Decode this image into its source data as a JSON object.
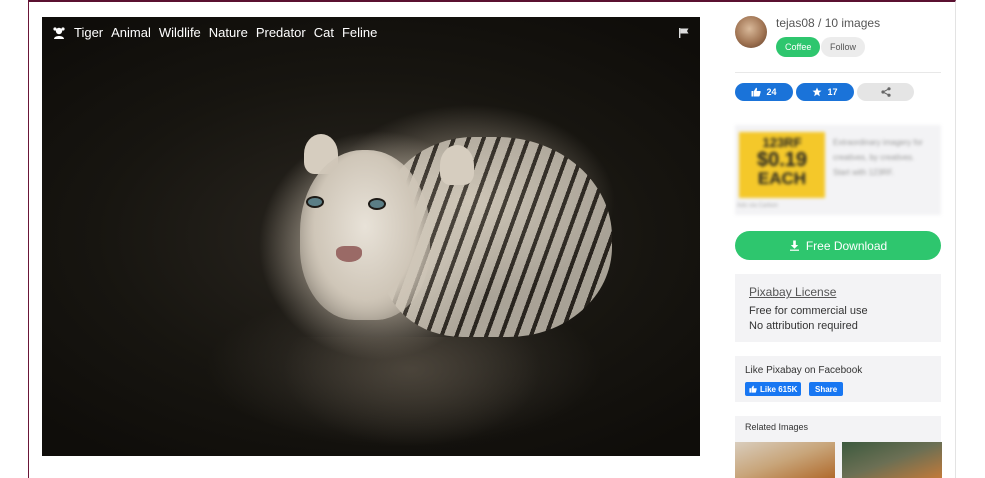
{
  "photo": {
    "tags": [
      "Tiger",
      "Animal",
      "Wildlife",
      "Nature",
      "Predator",
      "Cat",
      "Feline"
    ],
    "tag_icon": "tag-icon",
    "flag_icon": "flag-icon"
  },
  "author": {
    "name_line": "tejas08 / 10 images",
    "coffee_label": "Coffee",
    "follow_label": "Follow"
  },
  "stats": {
    "likes": "24",
    "favorites": "17",
    "like_icon": "thumbs-up-icon",
    "fav_icon": "star-icon",
    "share_icon": "share-icon"
  },
  "ad": {
    "brand": "123RF",
    "price": "$0.19",
    "each": "EACH",
    "text": "Extraordinary imagery for creatives, by creatives. Start with 123RF.",
    "foot": "Ads via Carbon"
  },
  "download": {
    "label": "Free Download",
    "icon": "download-icon"
  },
  "license": {
    "title": "Pixabay License",
    "line1": "Free for commercial use",
    "line2": "No attribution required"
  },
  "facebook": {
    "title": "Like Pixabay on Facebook",
    "like_label": "Like 615K",
    "share_label": "Share"
  },
  "related": {
    "title": "Related Images"
  },
  "colors": {
    "green": "#2ec66e",
    "blue": "#1a73d9",
    "facebook": "#1877f2"
  }
}
